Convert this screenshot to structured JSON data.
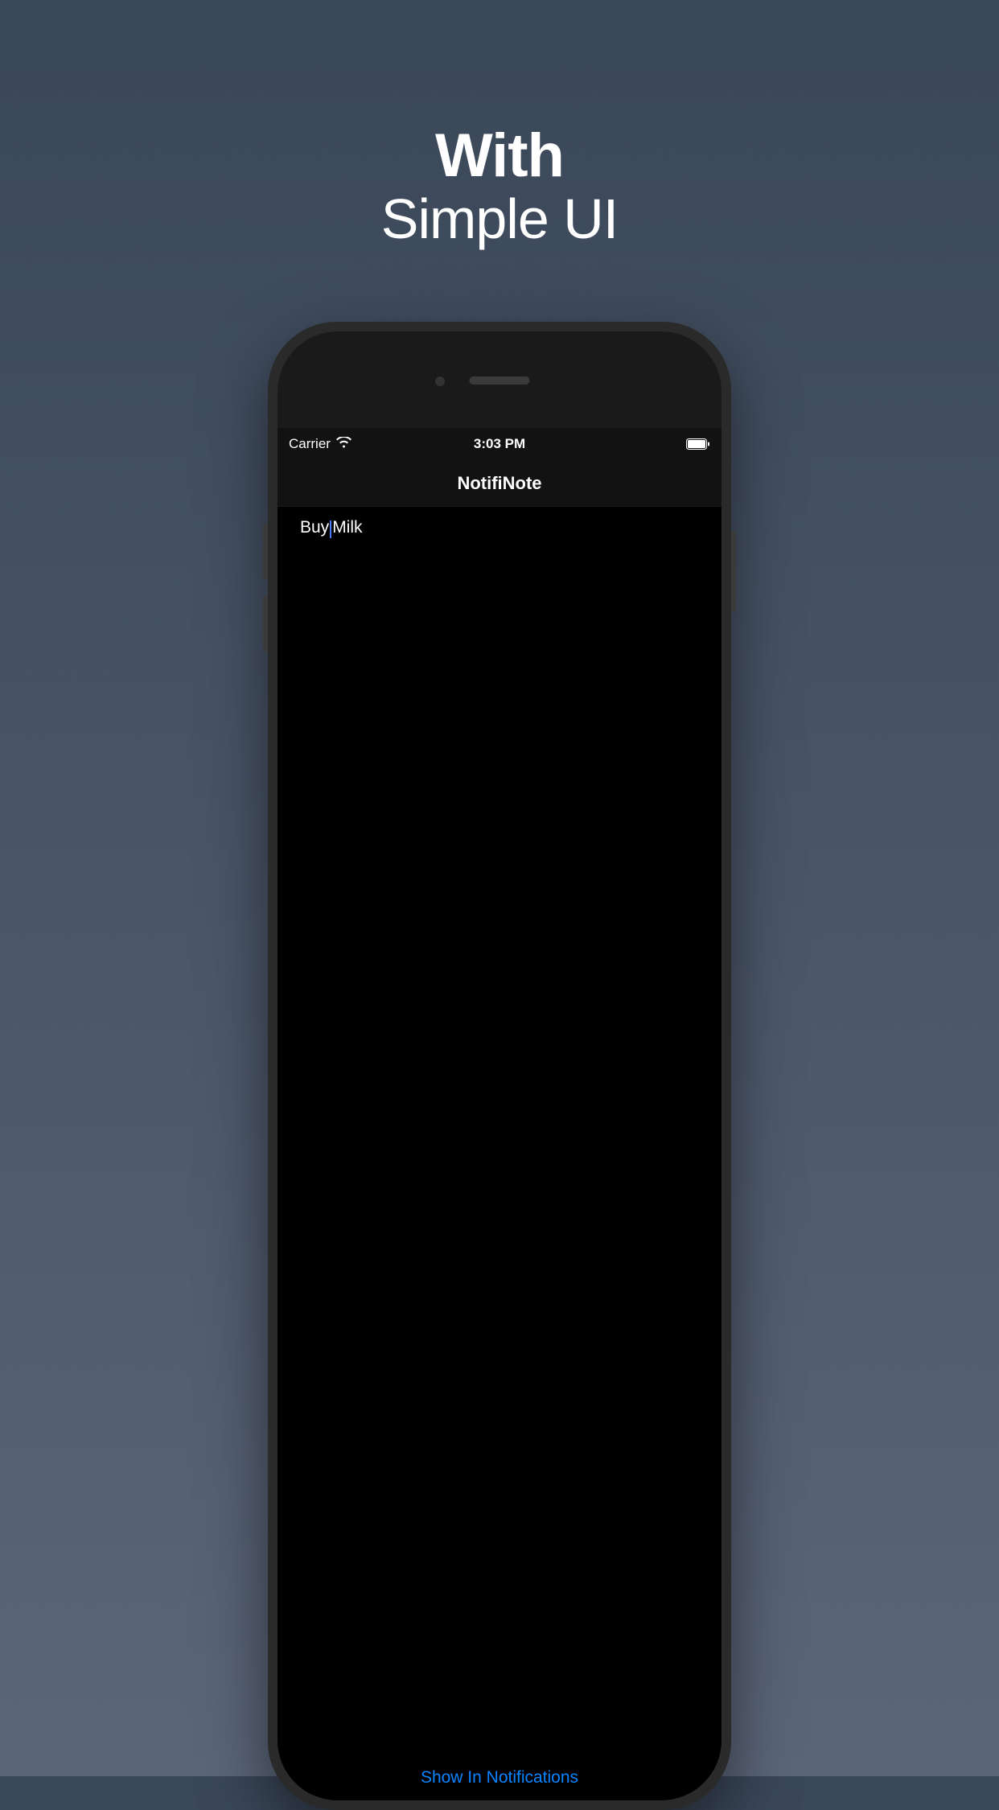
{
  "marketing": {
    "title": "With",
    "subtitle": "Simple UI"
  },
  "statusBar": {
    "carrier": "Carrier",
    "time": "3:03 PM"
  },
  "navBar": {
    "title": "NotifiNote"
  },
  "note": {
    "textBefore": "Buy",
    "textAfter": "Milk"
  },
  "bottomButton": {
    "label": "Show In Notifications"
  }
}
